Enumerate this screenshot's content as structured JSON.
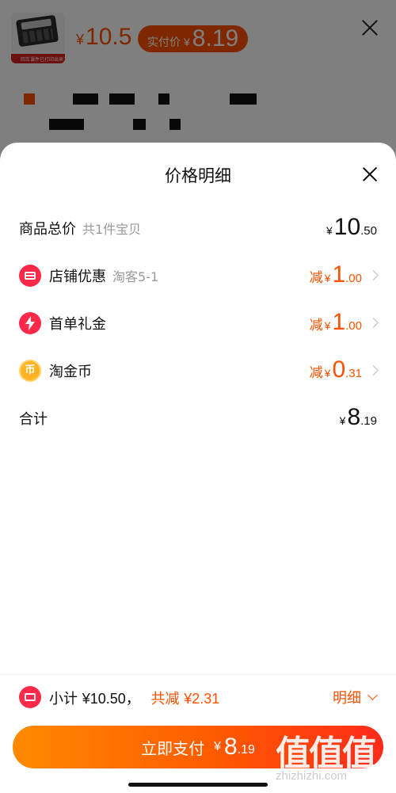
{
  "background_product": {
    "thumb_caption": "回车课件已打印出来了",
    "price_yen": "¥",
    "price": "10.5",
    "actual_pay_label": "实付价",
    "actual_pay_yen": "¥",
    "actual_pay_amount": "8.19"
  },
  "sheet": {
    "title": "价格明细"
  },
  "rows": [
    {
      "label": "商品总价",
      "sub": "共1件宝贝",
      "prefix": "",
      "yen": "¥",
      "int": "10",
      "dec": ".50",
      "color": "#111111",
      "icon": ""
    },
    {
      "label": "店铺优惠",
      "sub": "淘客5-1",
      "prefix": "减",
      "yen": "¥",
      "int": "1",
      "dec": ".00",
      "color": "#ff5000",
      "icon": "shop-icon"
    },
    {
      "label": "首单礼金",
      "sub": "",
      "prefix": "减",
      "yen": "¥",
      "int": "1",
      "dec": ".00",
      "color": "#ff5000",
      "icon": "lightning-icon"
    },
    {
      "label": "淘金币",
      "sub": "",
      "prefix": "减",
      "yen": "¥",
      "int": "0",
      "dec": ".31",
      "color": "#ff5000",
      "icon": "coin-icon"
    },
    {
      "label": "合计",
      "sub": "",
      "prefix": "",
      "yen": "¥",
      "int": "8",
      "dec": ".19",
      "color": "#111111",
      "icon": ""
    }
  ],
  "coin_glyph": "币",
  "summary": {
    "subtotal_label": "小计",
    "subtotal_amount": "¥10.50",
    "comma": "，",
    "discount_label": "共减",
    "discount_amount": "¥2.31",
    "detail_label": "明细"
  },
  "pay": {
    "label": "立即支付",
    "yen": "¥",
    "int": "8",
    "dec": ".19"
  },
  "watermark": {
    "chars": "值值值",
    "url": "zhizhizhi.com"
  },
  "colors": {
    "accent": "#ff5000",
    "badge_red": "#ff2a4a",
    "coin_gold": "#ffb322"
  }
}
